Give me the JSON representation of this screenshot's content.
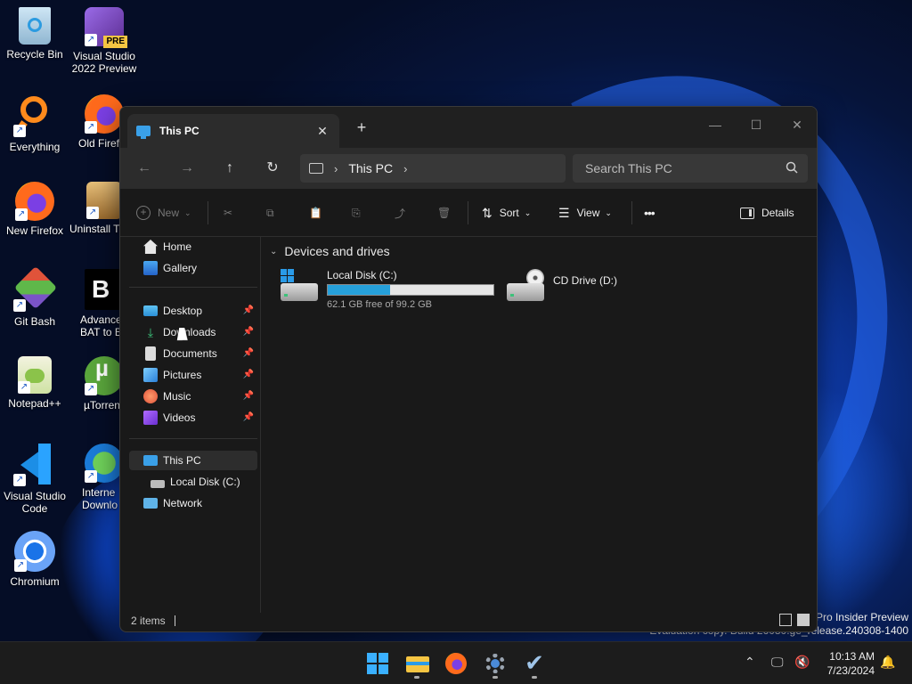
{
  "desktop": {
    "icons": [
      {
        "label": "Recycle Bin"
      },
      {
        "label": "Visual Studio 2022 Preview",
        "badge": "PRE"
      },
      {
        "label": "Everything"
      },
      {
        "label": "Old Firef"
      },
      {
        "label": "New Firefox"
      },
      {
        "label": "Uninstall T"
      },
      {
        "label": "Git Bash"
      },
      {
        "label": "Advance BAT to E"
      },
      {
        "label": "Notepad++"
      },
      {
        "label": "µTorren"
      },
      {
        "label": "Visual Studio Code"
      },
      {
        "label": "Interne Downlo"
      },
      {
        "label": "Chromium"
      }
    ],
    "watermark_line1": "Pro Insider Preview",
    "watermark_line2": "Evaluation copy. Build 26080.ge_release.240308-1400"
  },
  "window": {
    "tab_title": "This PC",
    "tab_close": "✕",
    "new_tab": "+",
    "controls": {
      "minimize": "—",
      "maximize": "☐",
      "close": "✕"
    },
    "address": {
      "breadcrumb": "This PC",
      "search_placeholder": "Search This PC"
    },
    "toolbar": {
      "new_label": "New",
      "sort_label": "Sort",
      "view_label": "View",
      "more_label": "•••",
      "details_label": "Details"
    },
    "navpane": {
      "home": "Home",
      "gallery": "Gallery",
      "desktop": "Desktop",
      "downloads": "Downloads",
      "documents": "Documents",
      "pictures": "Pictures",
      "music": "Music",
      "videos": "Videos",
      "this_pc": "This PC",
      "local_disk": "Local Disk (C:)",
      "network": "Network"
    },
    "content": {
      "section_title": "Devices and drives",
      "drives": [
        {
          "name": "Local Disk (C:)",
          "free_text": "62.1 GB free of 99.2 GB",
          "used_fraction": 0.374
        },
        {
          "name": "CD Drive (D:)"
        }
      ]
    },
    "status": {
      "items_text": "2 items"
    }
  },
  "taskbar": {
    "time": "10:13 AM",
    "date": "7/23/2024"
  }
}
